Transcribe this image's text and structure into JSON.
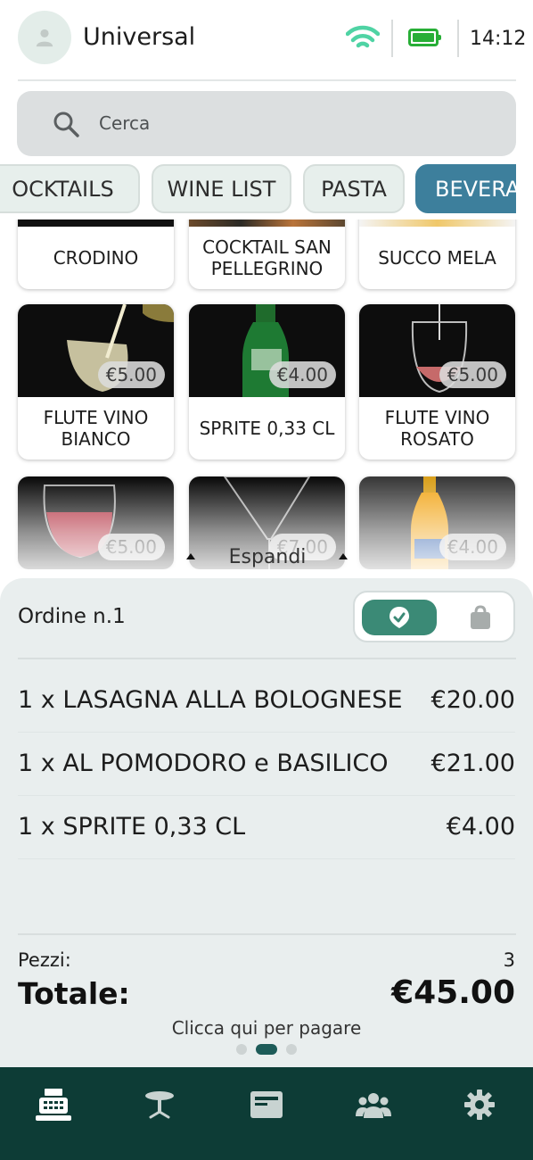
{
  "header": {
    "title": "Universal",
    "time": "14:12",
    "icons": [
      "user-icon",
      "wifi-icon",
      "battery-icon"
    ],
    "colors": {
      "wifi": "#4fd3a4",
      "battery": "#27ae36"
    }
  },
  "search": {
    "placeholder": "Cerca",
    "value": ""
  },
  "categories": {
    "tabs": [
      "OCKTAILS",
      "WINE LIST",
      "PASTA",
      "BEVERA"
    ],
    "active_index": 3,
    "active_color": "#3d7f9c"
  },
  "products": [
    {
      "name": "CRODINO",
      "price": ""
    },
    {
      "name": "COCKTAIL SAN PELLEGRINO",
      "price": ""
    },
    {
      "name": "SUCCO MELA",
      "price": ""
    },
    {
      "name": "FLUTE VINO BIANCO",
      "price": "€5.00"
    },
    {
      "name": "SPRITE 0,33 CL",
      "price": "€4.00"
    },
    {
      "name": "FLUTE VINO ROSATO",
      "price": "€5.00"
    },
    {
      "name": "",
      "price": "€5.00"
    },
    {
      "name": "",
      "price": "€7.00"
    },
    {
      "name": "",
      "price": "€4.00"
    }
  ],
  "expand_label": "Espandi",
  "order": {
    "title": "Ordine n.1",
    "items": [
      {
        "label": "1 x LASAGNA ALLA BOLOGNESE",
        "price": "€20.00"
      },
      {
        "label": "1 x  AL POMODORO e BASILICO",
        "price": "€21.00"
      },
      {
        "label": "1 x SPRITE 0,33 CL",
        "price": "€4.00"
      }
    ],
    "pieces_label": "Pezzi:",
    "pieces_value": "3",
    "total_label": "Totale:",
    "total_value": "€45.00",
    "pay_label": "Clicca qui per pagare",
    "page_indicator": {
      "count": 3,
      "active": 1
    },
    "toggle_colors": {
      "on": "#3b8a76"
    }
  },
  "bottom_nav": {
    "items": [
      "cash-register-icon",
      "table-icon",
      "card-icon",
      "users-icon",
      "settings-icon"
    ],
    "active_index": 0,
    "background": "#0d3c36"
  }
}
